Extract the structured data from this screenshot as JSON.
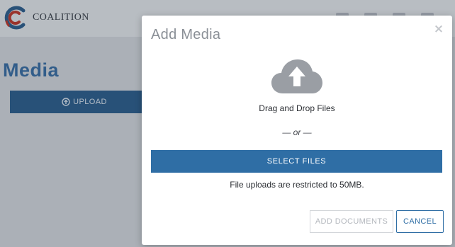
{
  "app": {
    "logo_text": "COALITION",
    "page_title": "Media",
    "upload_label": "UPLOAD"
  },
  "modal": {
    "title": "Add Media",
    "close_glyph": "×",
    "drop_text": "Drag and Drop Files",
    "or_text": "— or —",
    "select_files_label": "SELECT FILES",
    "restriction_text": "File uploads are restricted to 50MB.",
    "add_documents_label": "ADD DOCUMENTS",
    "add_documents_enabled": false,
    "cancel_label": "CANCEL"
  },
  "icons": {
    "logo": "coalition-logo-icon",
    "upload": "upload-circle-arrow-icon",
    "cloud": "cloud-upload-icon",
    "close": "close-icon"
  },
  "colors": {
    "primary": "#2f6ea5",
    "title_blue": "#3b6fa4",
    "logo_red": "#c0392b",
    "logo_blue": "#2f5f8e",
    "cloud_gray": "#9a9ea4"
  }
}
